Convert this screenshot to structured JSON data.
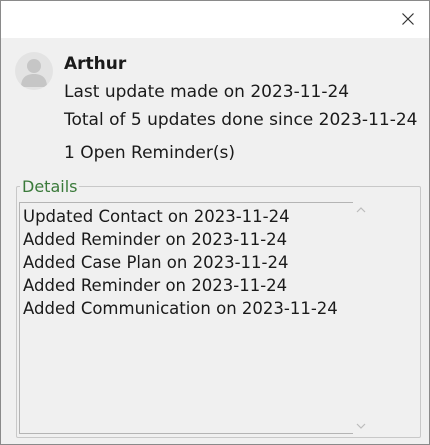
{
  "window": {
    "close_icon": "close-icon"
  },
  "user": {
    "name": "Arthur",
    "avatar_icon": "person-avatar-icon",
    "last_update": "Last update made on 2023-11-24",
    "total_updates": "Total of 5 updates done since 2023-11-24",
    "open_reminders": "1 Open Reminder(s)"
  },
  "details": {
    "label": "Details",
    "items": [
      "Updated Contact on 2023-11-24",
      "Added Reminder on 2023-11-24",
      "Added Case Plan on 2023-11-24",
      "Added Reminder on 2023-11-24",
      "Added Communication on 2023-11-24"
    ]
  },
  "colors": {
    "window_bg": "#f0f0f0",
    "titlebar_bg": "#ffffff",
    "legend_text": "#3a7a3a",
    "avatar_bg": "#e3e3e3"
  }
}
